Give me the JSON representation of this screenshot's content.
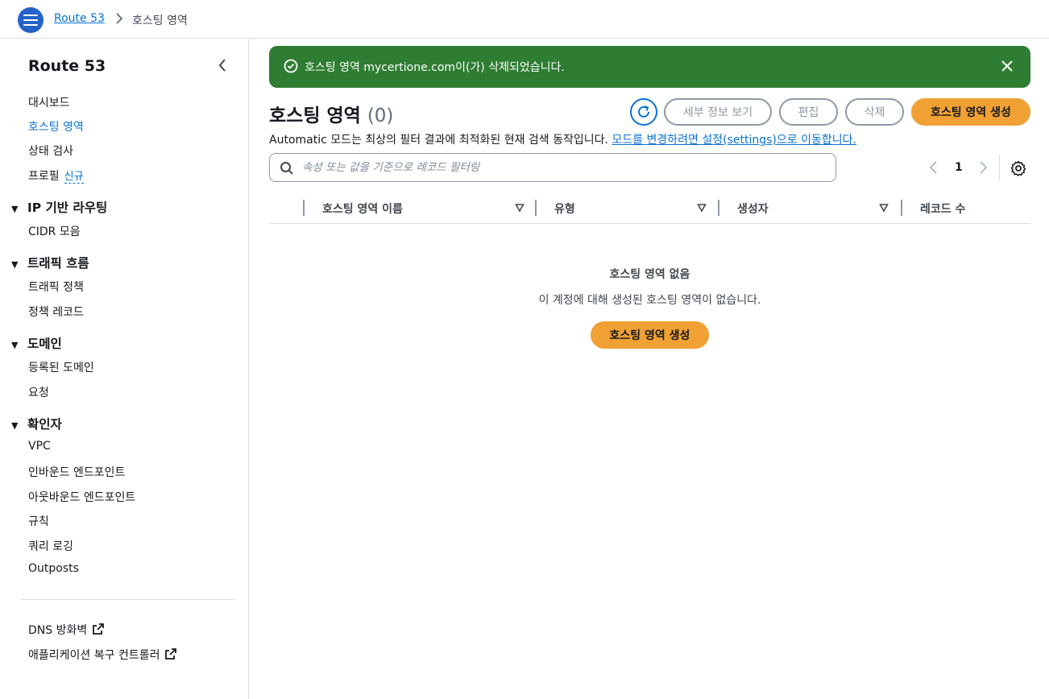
{
  "breadcrumb": {
    "root": "Route 53",
    "current": "호스팅 영역"
  },
  "sidebar": {
    "title": "Route 53",
    "items_top": [
      {
        "label": "대시보드"
      },
      {
        "label": "호스팅 영역",
        "active": true
      },
      {
        "label": "상태 검사"
      },
      {
        "label": "프로필",
        "badge": "신규"
      }
    ],
    "sections": [
      {
        "title": "IP 기반 라우팅",
        "items": [
          "CIDR 모음"
        ]
      },
      {
        "title": "트래픽 흐름",
        "items": [
          "트래픽 정책",
          "정책 레코드"
        ]
      },
      {
        "title": "도메인",
        "items": [
          "등록된 도메인",
          "요청"
        ]
      },
      {
        "title": "확인자",
        "items": [
          "VPC",
          "인바운드 엔드포인트",
          "아웃바운드 엔드포인트",
          "규칙",
          "쿼리 로깅",
          "Outposts"
        ]
      }
    ],
    "footer_links": [
      "DNS 방화벽",
      "애플리케이션 복구 컨트롤러"
    ]
  },
  "flash": {
    "message": "호스팅 영역 mycertione.com이(가) 삭제되었습니다.",
    "type": "success",
    "color": "#2e7d32"
  },
  "header": {
    "title": "호스팅 영역",
    "count": "(0)",
    "buttons": {
      "details": "세부 정보 보기",
      "edit": "편집",
      "delete": "삭제",
      "create": "호스팅 영역 생성"
    },
    "description": "Automatic 모드는 최상의 필터 결과에 최적화된 현재 검색 동작입니다.",
    "description_link": "모드를 변경하려면 설정(settings)으로 이동합니다."
  },
  "search": {
    "placeholder": "속성 또는 값을 기준으로 레코드 필터링",
    "value": ""
  },
  "pagination": {
    "current_page": "1"
  },
  "table": {
    "columns": [
      "호스팅 영역 이름",
      "유형",
      "생성자",
      "레코드 수"
    ]
  },
  "empty": {
    "title": "호스팅 영역 없음",
    "description": "이 계정에 대해 생성된 호스팅 영역이 없습니다.",
    "button": "호스팅 영역 생성"
  },
  "colors": {
    "accent": "#0972d3",
    "primary_button": "#f1a033",
    "success": "#2e7d32"
  }
}
